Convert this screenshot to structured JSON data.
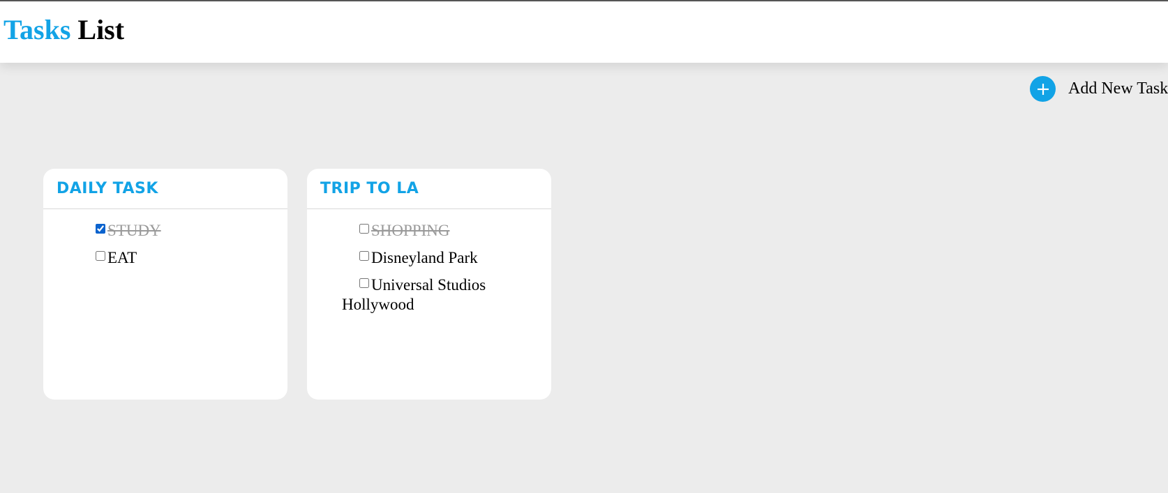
{
  "header": {
    "title_accent": "Tasks",
    "title_rest": "List",
    "accent_color": "#12a3e6"
  },
  "actions": {
    "add_icon": "plus-icon",
    "add_label": "Add New Task"
  },
  "lists": [
    {
      "title": "DAILY TASK",
      "tasks": [
        {
          "label": "STUDY",
          "checked": true,
          "done": true
        },
        {
          "label": "EAT",
          "checked": false,
          "done": false
        }
      ]
    },
    {
      "title": "TRIP TO LA",
      "tasks": [
        {
          "label": "SHOPPING",
          "checked": false,
          "done": true
        },
        {
          "label": "Disneyland Park",
          "checked": false,
          "done": false
        },
        {
          "label": "Universal Studios Hollywood",
          "checked": false,
          "done": false
        }
      ]
    }
  ]
}
